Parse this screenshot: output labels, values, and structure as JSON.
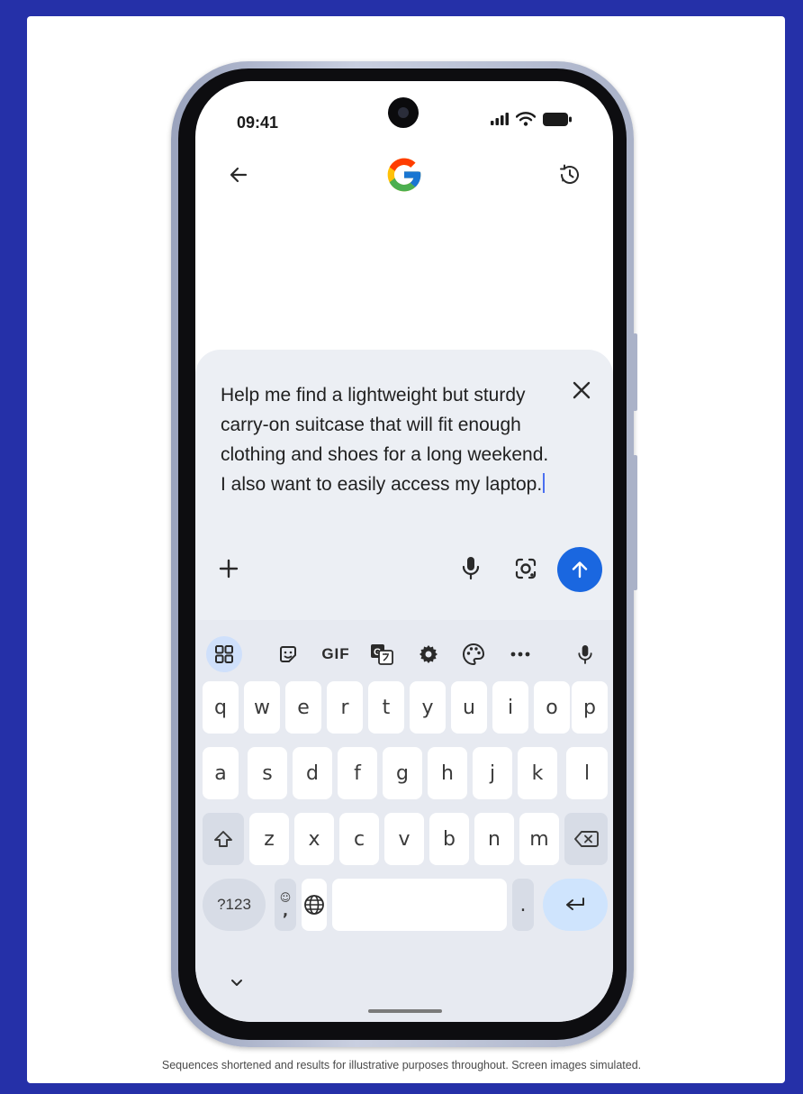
{
  "status_bar": {
    "time": "09:41"
  },
  "top_bar": {
    "back_icon": "arrow-left-icon",
    "logo": "google-g-logo",
    "history_icon": "history-icon"
  },
  "query": {
    "text": "Help me find a lightweight but sturdy carry-on suitcase that will fit enough clothing and shoes for a long weekend. I also want to easily access my laptop."
  },
  "actions": {
    "add_icon": "plus-icon",
    "mic_icon": "mic-icon",
    "lens_icon": "lens-icon",
    "send_icon": "arrow-up-icon",
    "send_color": "#1a67e0"
  },
  "keyboard": {
    "toolbar": {
      "gif_label": "GIF"
    },
    "row1": [
      "q",
      "w",
      "e",
      "r",
      "t",
      "y",
      "u",
      "i",
      "o",
      "p"
    ],
    "row2": [
      "a",
      "s",
      "d",
      "f",
      "g",
      "h",
      "j",
      "k",
      "l"
    ],
    "row3": [
      "z",
      "x",
      "c",
      "v",
      "b",
      "n",
      "m"
    ],
    "symbols_label": "?123",
    "comma_label": ",",
    "period_label": "."
  },
  "disclaimer": "Sequences shortened and results for illustrative purposes throughout. Screen images simulated."
}
